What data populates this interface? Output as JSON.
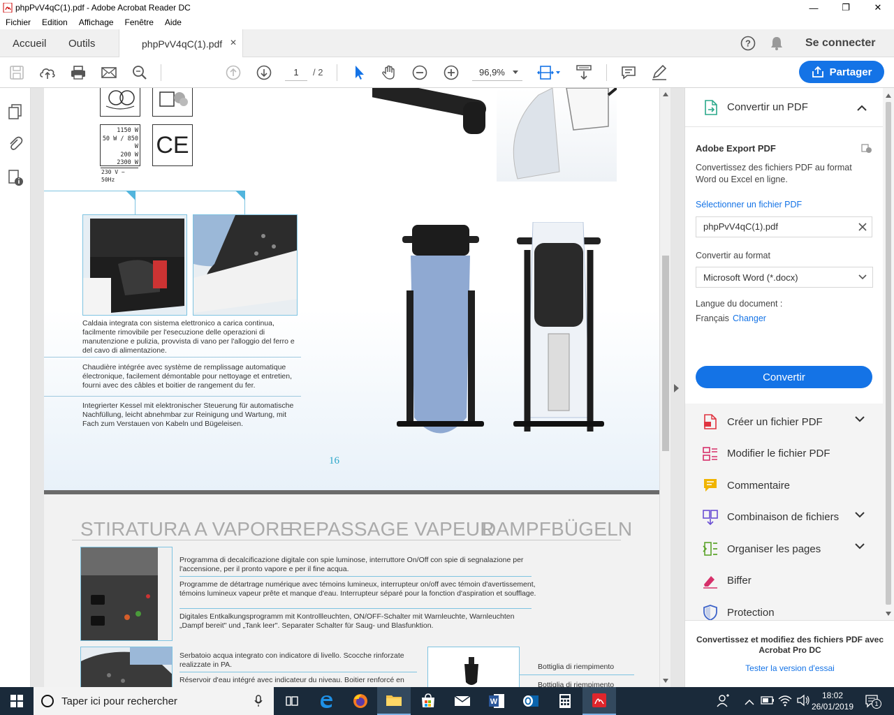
{
  "window": {
    "title": "phpPvV4qC(1).pdf - Adobe Acrobat Reader DC",
    "controls": {
      "minimize": "—",
      "maximize": "❐",
      "close": "✕"
    }
  },
  "menu": [
    "Fichier",
    "Edition",
    "Affichage",
    "Fenêtre",
    "Aide"
  ],
  "tabs": {
    "home": "Accueil",
    "tools": "Outils",
    "document": "phpPvV4qC(1).pdf",
    "close": "✕"
  },
  "header_right": {
    "connect": "Se connecter"
  },
  "toolbar": {
    "page_current": "1",
    "page_total": "/ 2",
    "zoom": "96,9%",
    "share_label": "Partager"
  },
  "document": {
    "page1": {
      "specs": [
        "1150 W",
        "50 W / 850 W",
        "200 W",
        "2300 W",
        "230 V ~ 50Hz"
      ],
      "ce_mark": "CE",
      "text_it": "Caldaia integrata con sistema elettronico  a carica continua, facilmente rimovibile per l'esecuzione delle operazioni di manutenzione e pulizia, provvista di vano per l'alloggio del ferro e del cavo di alimentazione.",
      "text_fr": "Chaudière intégrée avec système de remplissage automatique électronique, facilement démontable pour nettoyage et entretien, fourni avec des câbles et boitier de rangement du fer.",
      "text_de": "Integrierter Kessel mit elektronischer Steuerung für automatische Nachfüllung, leicht abnehmbar zur Reinigung und Wartung, mit Fach zum Verstauen von Kabeln und Bügeleisen.",
      "page_number": "16"
    },
    "page2": {
      "heading_it": "STIRATURA A VAPORE",
      "heading_fr": "REPASSAGE VAPEUR",
      "heading_de": "DAMPFBÜGELN",
      "block1_it": "Programma di decalcificazione digitale con spie luminose,  interruttore On/Off con spie di segnalazione  per l'accensione,  per il pronto vapore e per il fine acqua.",
      "block1_fr": "Programme de détartrage numérique avec témoins lumineux, interrupteur on/off avec témoin d'avertissement, témoins lumineux vapeur prête et manque d'eau. Interrupteur séparé pour la fonction d'aspiration et soufflage.",
      "block1_de": "Digitales Entkalkungsprogramm mit Kontrollleuchten, ON/OFF-Schalter mit Warnleuchte, Warnleuchten „Dampf bereit\" und „Tank leer\". Separater Schalter für Saug- und Blasfunktion.",
      "block2_it": "Serbatoio acqua integrato con indicatore di livello. Scocche rinforzate realizzate in PA.",
      "block2_fr": "Réservoir d'eau intégré avec indicateur du niveau. Boitier renforcé en",
      "bottle_label": "Bottiglia di riempimento",
      "bottle_label2": "Bottiglia di riempimento"
    }
  },
  "right_pane": {
    "convert_header": "Convertir un PDF",
    "service_title": "Adobe Export PDF",
    "service_desc": "Convertissez des fichiers PDF au format Word ou Excel en ligne.",
    "select_link": "Sélectionner un fichier PDF",
    "selected_file": "phpPvV4qC(1).pdf",
    "format_label": "Convertir au format",
    "format_value": "Microsoft Word (*.docx)",
    "lang_label": "Langue du document :",
    "lang_value": "Français",
    "lang_change": "Changer",
    "convert_button": "Convertir",
    "tools": [
      {
        "label": "Créer un fichier PDF",
        "icon": "create-pdf-icon",
        "color": "#e0333f",
        "expand": true
      },
      {
        "label": "Modifier le fichier PDF",
        "icon": "edit-pdf-icon",
        "color": "#d6306a",
        "expand": false
      },
      {
        "label": "Commentaire",
        "icon": "comment-icon",
        "color": "#f0b400",
        "expand": false
      },
      {
        "label": "Combinaison de fichiers",
        "icon": "combine-files-icon",
        "color": "#6a4fd3",
        "expand": true
      },
      {
        "label": "Organiser les pages",
        "icon": "organize-pages-icon",
        "color": "#5ca32b",
        "expand": true
      },
      {
        "label": "Biffer",
        "icon": "redact-icon",
        "color": "#d6306a",
        "expand": false
      },
      {
        "label": "Protection",
        "icon": "protect-icon",
        "color": "#3d63c9",
        "expand": false
      }
    ],
    "promo_text": "Convertissez et modifiez des fichiers PDF avec Acrobat Pro DC",
    "promo_link": "Tester la version d'essai"
  },
  "taskbar": {
    "search_placeholder": "Taper ici pour rechercher",
    "time": "18:02",
    "date": "26/01/2019",
    "notification_count": "1"
  },
  "colors": {
    "accent": "#1473e6",
    "link": "#1473e6",
    "taskbar": "#1a2a3a",
    "page_number": "#2aa6c9"
  }
}
